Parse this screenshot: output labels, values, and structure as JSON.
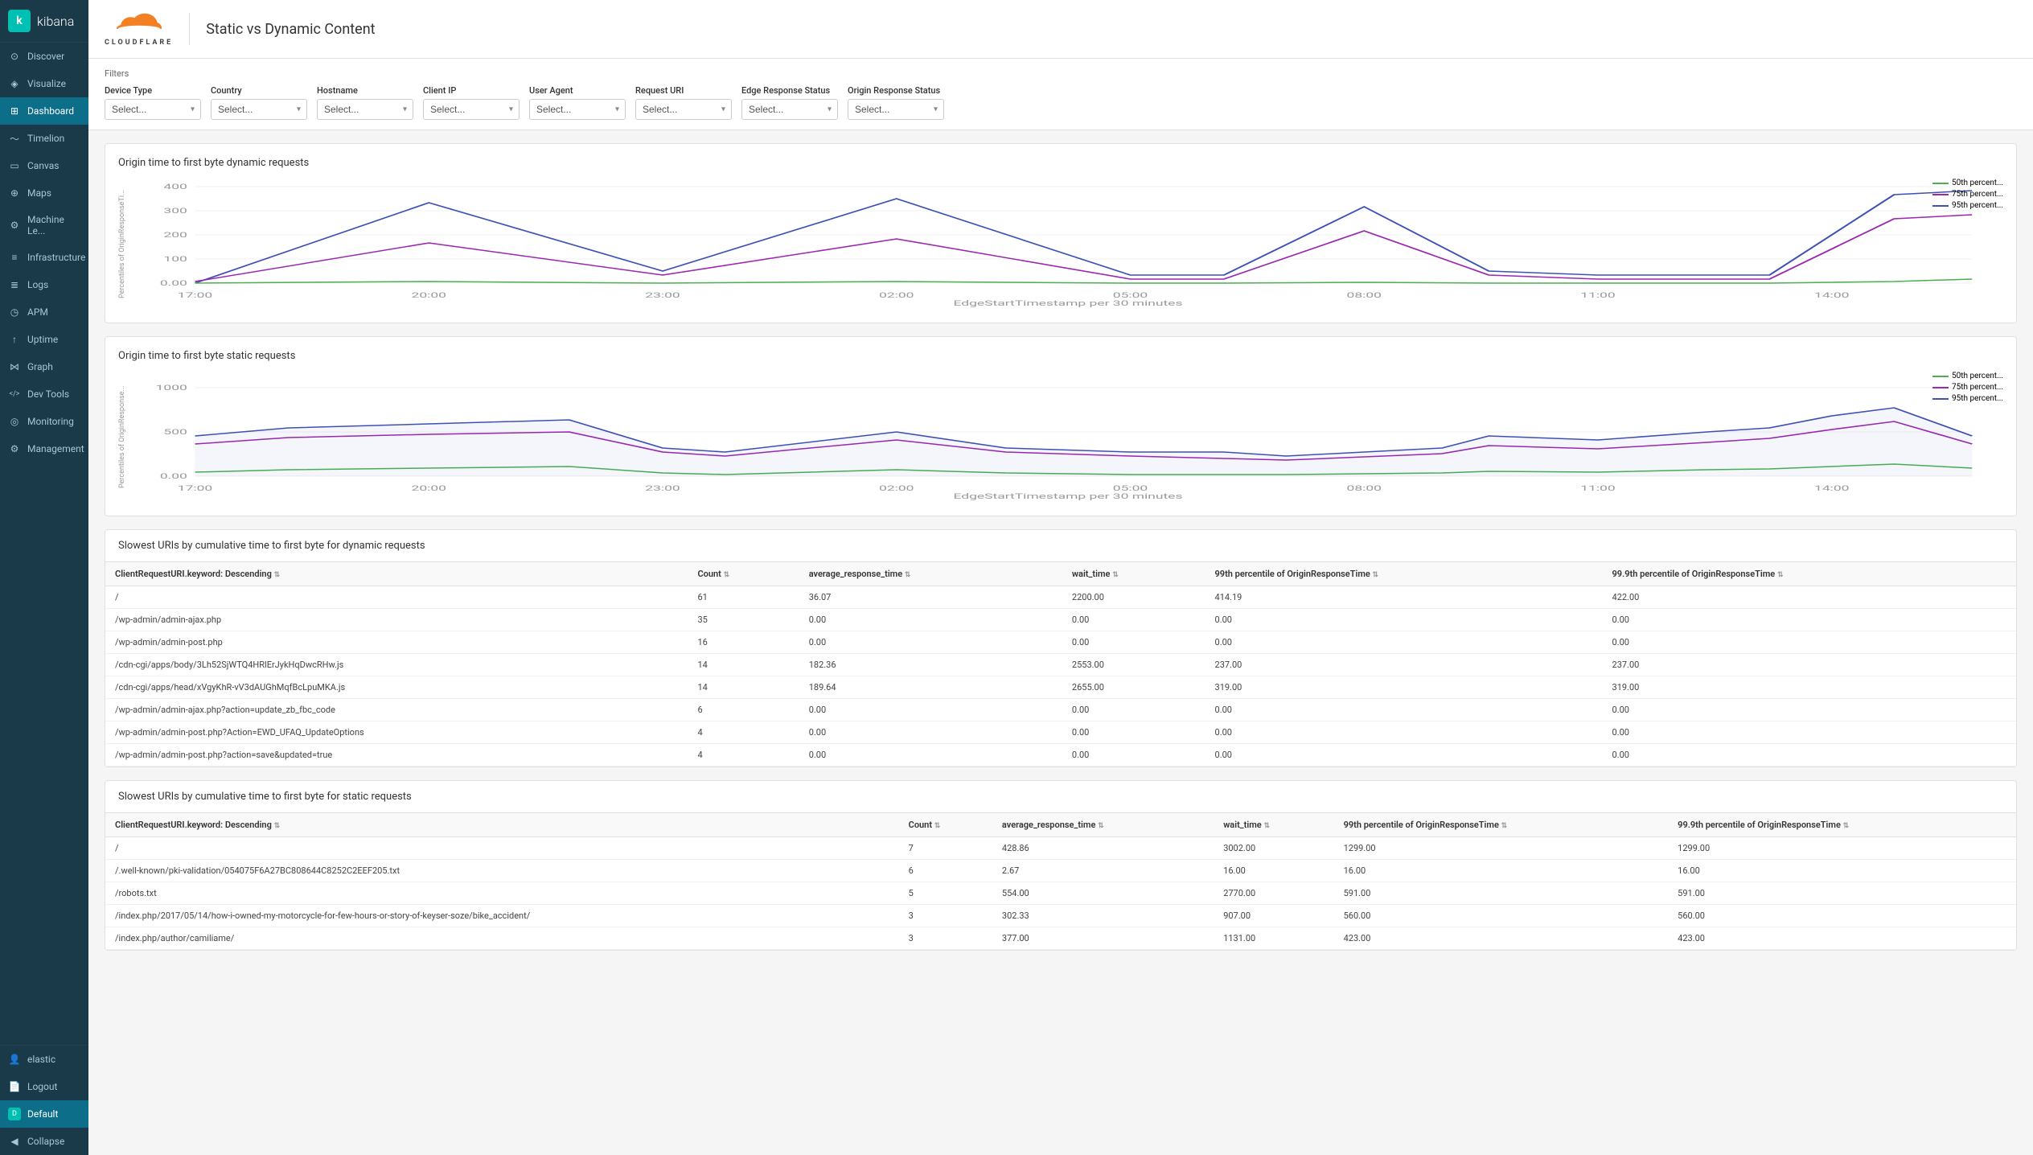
{
  "app": {
    "name": "kibana"
  },
  "sidebar": {
    "logo_text": "kibana",
    "items": [
      {
        "id": "discover",
        "label": "Discover",
        "icon": "compass-icon",
        "active": false
      },
      {
        "id": "visualize",
        "label": "Visualize",
        "icon": "chart-icon",
        "active": false
      },
      {
        "id": "dashboard",
        "label": "Dashboard",
        "icon": "dashboard-icon",
        "active": true
      },
      {
        "id": "timelion",
        "label": "Timelion",
        "icon": "timelion-icon",
        "active": false
      },
      {
        "id": "canvas",
        "label": "Canvas",
        "icon": "canvas-icon",
        "active": false
      },
      {
        "id": "maps",
        "label": "Maps",
        "icon": "map-icon",
        "active": false
      },
      {
        "id": "machine-learning",
        "label": "Machine Le...",
        "icon": "ml-icon",
        "active": false
      },
      {
        "id": "infrastructure",
        "label": "Infrastructure",
        "icon": "infra-icon",
        "active": false
      },
      {
        "id": "logs",
        "label": "Logs",
        "icon": "logs-icon",
        "active": false
      },
      {
        "id": "apm",
        "label": "APM",
        "icon": "apm-icon",
        "active": false
      },
      {
        "id": "uptime",
        "label": "Uptime",
        "icon": "uptime-icon",
        "active": false
      },
      {
        "id": "graph",
        "label": "Graph",
        "icon": "graph-icon",
        "active": false
      },
      {
        "id": "dev-tools",
        "label": "Dev Tools",
        "icon": "devtools-icon",
        "active": false
      },
      {
        "id": "monitoring",
        "label": "Monitoring",
        "icon": "monitoring-icon",
        "active": false
      },
      {
        "id": "management",
        "label": "Management",
        "icon": "management-icon",
        "active": false
      }
    ],
    "bottom_items": [
      {
        "id": "elastic",
        "label": "elastic",
        "icon": "user-icon"
      },
      {
        "id": "logout",
        "label": "Logout",
        "icon": "logout-icon"
      },
      {
        "id": "default",
        "label": "Default",
        "icon": "default-icon",
        "highlighted": true
      },
      {
        "id": "collapse",
        "label": "Collapse",
        "icon": "collapse-icon"
      }
    ]
  },
  "header": {
    "title": "Static vs Dynamic Content",
    "logo_alt": "Cloudflare"
  },
  "filters": {
    "label": "Filters",
    "items": [
      {
        "id": "device-type",
        "label": "Device Type",
        "placeholder": "Select..."
      },
      {
        "id": "country",
        "label": "Country",
        "placeholder": "Select..."
      },
      {
        "id": "hostname",
        "label": "Hostname",
        "placeholder": "Select..."
      },
      {
        "id": "client-ip",
        "label": "Client IP",
        "placeholder": "Select..."
      },
      {
        "id": "user-agent",
        "label": "User Agent",
        "placeholder": "Select..."
      },
      {
        "id": "request-uri",
        "label": "Request URI",
        "placeholder": "Select..."
      },
      {
        "id": "edge-response-status",
        "label": "Edge Response Status",
        "placeholder": "Select..."
      },
      {
        "id": "origin-response-status",
        "label": "Origin Response Status",
        "placeholder": "Select..."
      }
    ]
  },
  "chart1": {
    "title": "Origin time to first byte dynamic requests",
    "y_label": "Percentiles of OriginResponseTi...",
    "x_label": "EdgeStartTimestamp per 30 minutes",
    "x_ticks": [
      "17:00",
      "20:00",
      "23:00",
      "02:00",
      "05:00",
      "08:00",
      "11:00",
      "14:00"
    ],
    "y_ticks": [
      "400",
      "300",
      "200",
      "100",
      "0.00"
    ],
    "legend": [
      {
        "label": "50th percent...",
        "color": "#4caf50"
      },
      {
        "label": "75th percent...",
        "color": "#9c27b0"
      },
      {
        "label": "95th percent...",
        "color": "#3f51b5"
      }
    ]
  },
  "chart2": {
    "title": "Origin time to first byte static requests",
    "y_label": "Percentiles of OriginResponse...",
    "x_label": "EdgeStartTimestamp per 30 minutes",
    "x_ticks": [
      "17:00",
      "20:00",
      "23:00",
      "02:00",
      "05:00",
      "08:00",
      "11:00",
      "14:00"
    ],
    "y_ticks": [
      "1000",
      "500",
      "0.00"
    ],
    "legend": [
      {
        "label": "50th percent...",
        "color": "#4caf50"
      },
      {
        "label": "75th percent...",
        "color": "#9c27b0"
      },
      {
        "label": "95th percent...",
        "color": "#3f51b5"
      }
    ]
  },
  "table1": {
    "title": "Slowest URIs by cumulative time to first byte for dynamic requests",
    "columns": [
      {
        "label": "ClientRequestURI.keyword: Descending",
        "sort": true
      },
      {
        "label": "Count",
        "sort": true
      },
      {
        "label": "average_response_time",
        "sort": true
      },
      {
        "label": "wait_time",
        "sort": true
      },
      {
        "label": "99th percentile of OriginResponseTime",
        "sort": true
      },
      {
        "label": "99.9th percentile of OriginResponseTime",
        "sort": true
      }
    ],
    "rows": [
      {
        "uri": "/",
        "count": "61",
        "avg_response": "36.07",
        "wait_time": "2200.00",
        "p99": "414.19",
        "p999": "422.00"
      },
      {
        "uri": "/wp-admin/admin-ajax.php",
        "count": "35",
        "avg_response": "0.00",
        "wait_time": "0.00",
        "p99": "0.00",
        "p999": "0.00"
      },
      {
        "uri": "/wp-admin/admin-post.php",
        "count": "16",
        "avg_response": "0.00",
        "wait_time": "0.00",
        "p99": "0.00",
        "p999": "0.00"
      },
      {
        "uri": "/cdn-cgi/apps/body/3Lh52SjWTQ4HRlErJykHqDwcRHw.js",
        "count": "14",
        "avg_response": "182.36",
        "wait_time": "2553.00",
        "p99": "237.00",
        "p999": "237.00"
      },
      {
        "uri": "/cdn-cgi/apps/head/xVgyKhR-vV3dAUGhMqfBcLpuMKA.js",
        "count": "14",
        "avg_response": "189.64",
        "wait_time": "2655.00",
        "p99": "319.00",
        "p999": "319.00"
      },
      {
        "uri": "/wp-admin/admin-ajax.php?action=update_zb_fbc_code",
        "count": "6",
        "avg_response": "0.00",
        "wait_time": "0.00",
        "p99": "0.00",
        "p999": "0.00"
      },
      {
        "uri": "/wp-admin/admin-post.php?Action=EWD_UFAQ_UpdateOptions",
        "count": "4",
        "avg_response": "0.00",
        "wait_time": "0.00",
        "p99": "0.00",
        "p999": "0.00"
      },
      {
        "uri": "/wp-admin/admin-post.php?action=save&updated=true",
        "count": "4",
        "avg_response": "0.00",
        "wait_time": "0.00",
        "p99": "0.00",
        "p999": "0.00"
      }
    ]
  },
  "table2": {
    "title": "Slowest URIs by cumulative time to first byte for static requests",
    "columns": [
      {
        "label": "ClientRequestURI.keyword: Descending",
        "sort": true
      },
      {
        "label": "Count",
        "sort": true
      },
      {
        "label": "average_response_time",
        "sort": true
      },
      {
        "label": "wait_time",
        "sort": true
      },
      {
        "label": "99th percentile of OriginResponseTime",
        "sort": true
      },
      {
        "label": "99.9th percentile of OriginResponseTime",
        "sort": true
      }
    ],
    "rows": [
      {
        "uri": "/",
        "count": "7",
        "avg_response": "428.86",
        "wait_time": "3002.00",
        "p99": "1299.00",
        "p999": "1299.00"
      },
      {
        "uri": "/.well-known/pki-validation/054075F6A27BC808644C8252C2EEF205.txt",
        "count": "6",
        "avg_response": "2.67",
        "wait_time": "16.00",
        "p99": "16.00",
        "p999": "16.00"
      },
      {
        "uri": "/robots.txt",
        "count": "5",
        "avg_response": "554.00",
        "wait_time": "2770.00",
        "p99": "591.00",
        "p999": "591.00"
      },
      {
        "uri": "/index.php/2017/05/14/how-i-owned-my-motorcycle-for-few-hours-or-story-of-keyser-soze/bike_accident/",
        "count": "3",
        "avg_response": "302.33",
        "wait_time": "907.00",
        "p99": "560.00",
        "p999": "560.00"
      },
      {
        "uri": "/index.php/author/camiliame/",
        "count": "3",
        "avg_response": "377.00",
        "wait_time": "1131.00",
        "p99": "423.00",
        "p999": "423.00"
      }
    ]
  }
}
